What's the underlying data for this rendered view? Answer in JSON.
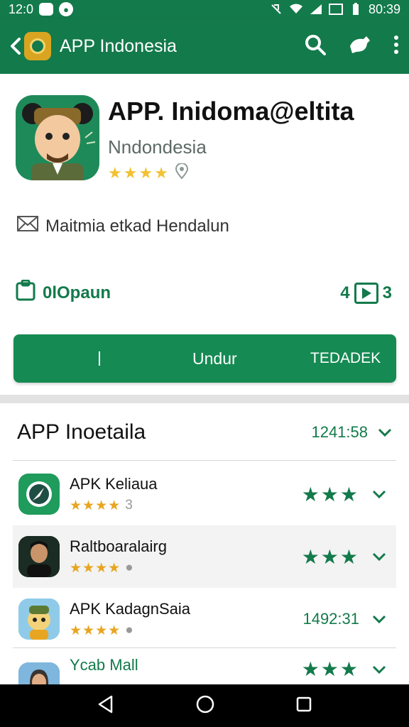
{
  "status_bar": {
    "time": "12:0",
    "battery_time": "80:39"
  },
  "app_bar": {
    "title": "APP Indonesia"
  },
  "app": {
    "title": "APP. Inidoma@eltita",
    "subtitle": "Nndondesia",
    "message": "Maitmia etkad Hendalun",
    "size_label": "0lOpaun",
    "size_right_a": "4",
    "size_right_b": "3"
  },
  "install": {
    "label": "Undur",
    "extra": "TEDADEK"
  },
  "list": {
    "title": "APP Inoetaila",
    "count": "1241:58",
    "items": [
      {
        "name": "APK Keliaua",
        "sub_num": "3"
      },
      {
        "name": "Raltboaralairg"
      },
      {
        "name": "APK KadagnSaia",
        "count": "1492:31"
      },
      {
        "name": "Ycab Mall"
      }
    ]
  },
  "colors": {
    "primary": "#137a4b",
    "accent_star": "#f2c233",
    "install_button": "#158a53"
  }
}
